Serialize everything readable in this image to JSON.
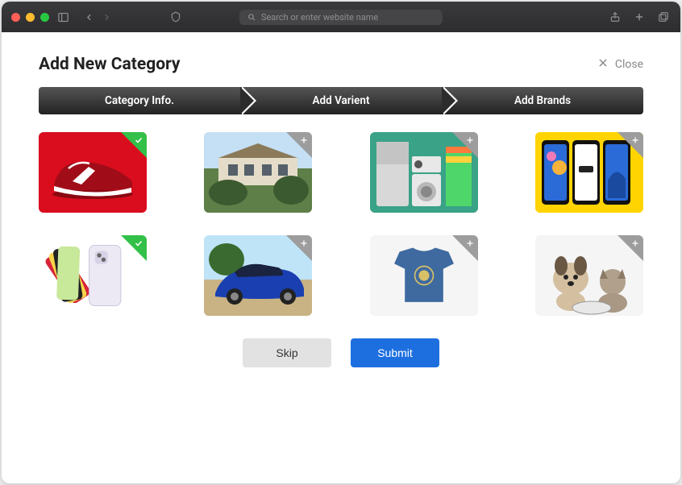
{
  "browser": {
    "search_placeholder": "Search or enter website name"
  },
  "header": {
    "title": "Add New Category",
    "close_label": "Close"
  },
  "stepper": {
    "steps": [
      "Category Info.",
      "Add Varient",
      "Add Brands"
    ]
  },
  "cards": [
    {
      "name": "shoe",
      "selected": true
    },
    {
      "name": "house",
      "selected": false
    },
    {
      "name": "appliances",
      "selected": false
    },
    {
      "name": "phones",
      "selected": false
    },
    {
      "name": "iphone",
      "selected": true
    },
    {
      "name": "car",
      "selected": false
    },
    {
      "name": "tshirt",
      "selected": false
    },
    {
      "name": "pets",
      "selected": false
    }
  ],
  "actions": {
    "skip_label": "Skip",
    "submit_label": "Submit"
  },
  "colors": {
    "selected_badge": "#33c048",
    "unselected_badge": "#9d9d9d",
    "primary": "#1d6fe0"
  }
}
